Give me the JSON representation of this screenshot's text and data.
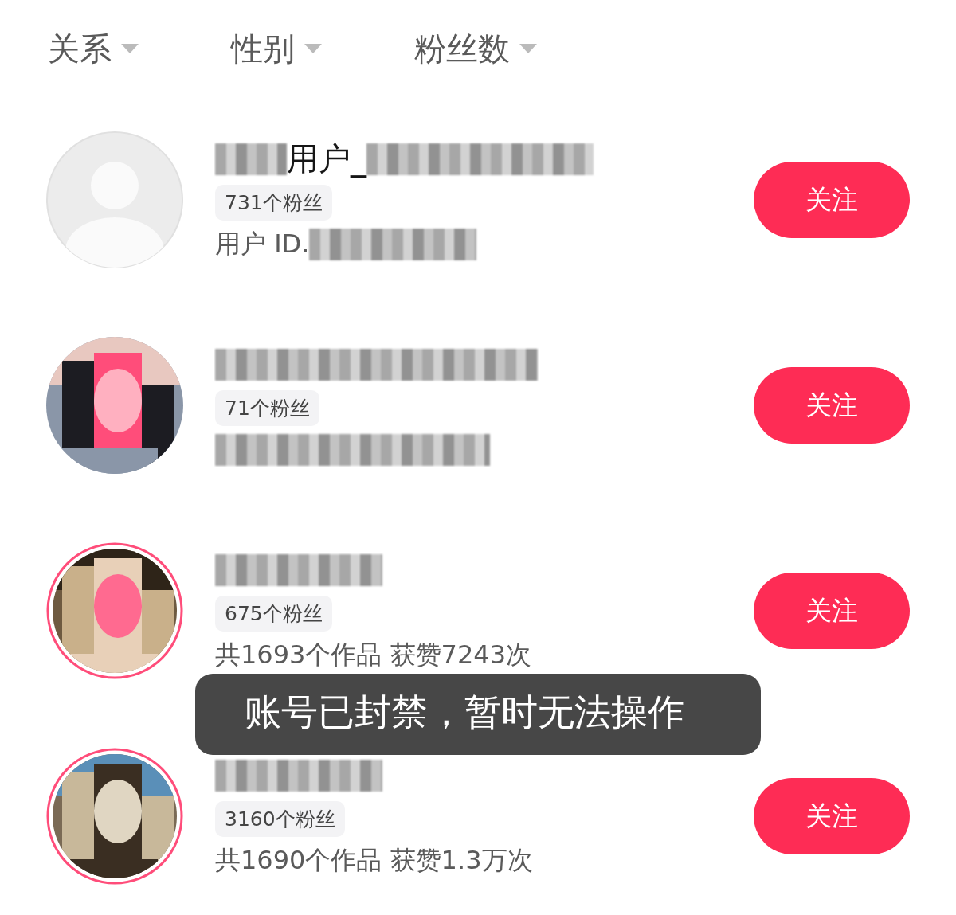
{
  "filters": [
    {
      "label": "关系"
    },
    {
      "label": "性别"
    },
    {
      "label": "粉丝数"
    }
  ],
  "users": [
    {
      "avatar": {
        "kind": "default"
      },
      "ring": false,
      "name_parts": [
        {
          "kind": "blur"
        },
        {
          "kind": "text",
          "text": "用户_"
        },
        {
          "kind": "blur"
        }
      ],
      "followers": "731个粉丝",
      "detail_parts": [
        {
          "kind": "text",
          "text": "用户 ID."
        },
        {
          "kind": "blur"
        }
      ],
      "button": "关注"
    },
    {
      "avatar": {
        "kind": "picture"
      },
      "ring": false,
      "name_parts": [
        {
          "kind": "blur"
        }
      ],
      "followers": "71个粉丝",
      "detail_parts": [
        {
          "kind": "blur"
        }
      ],
      "button": "关注"
    },
    {
      "avatar": {
        "kind": "picture"
      },
      "ring": true,
      "name_parts": [
        {
          "kind": "blur"
        }
      ],
      "followers": "675个粉丝",
      "detail_parts": [
        {
          "kind": "text",
          "text": "共1693个作品 获赞7243次"
        }
      ],
      "button": "关注"
    },
    {
      "avatar": {
        "kind": "picture"
      },
      "ring": true,
      "name_parts": [
        {
          "kind": "blur"
        }
      ],
      "followers": "3160个粉丝",
      "detail_parts": [
        {
          "kind": "text",
          "text": "共1690个作品 获赞1.3万次"
        }
      ],
      "button": "关注"
    }
  ],
  "toast": {
    "text": "账号已封禁，暂时无法操作"
  }
}
